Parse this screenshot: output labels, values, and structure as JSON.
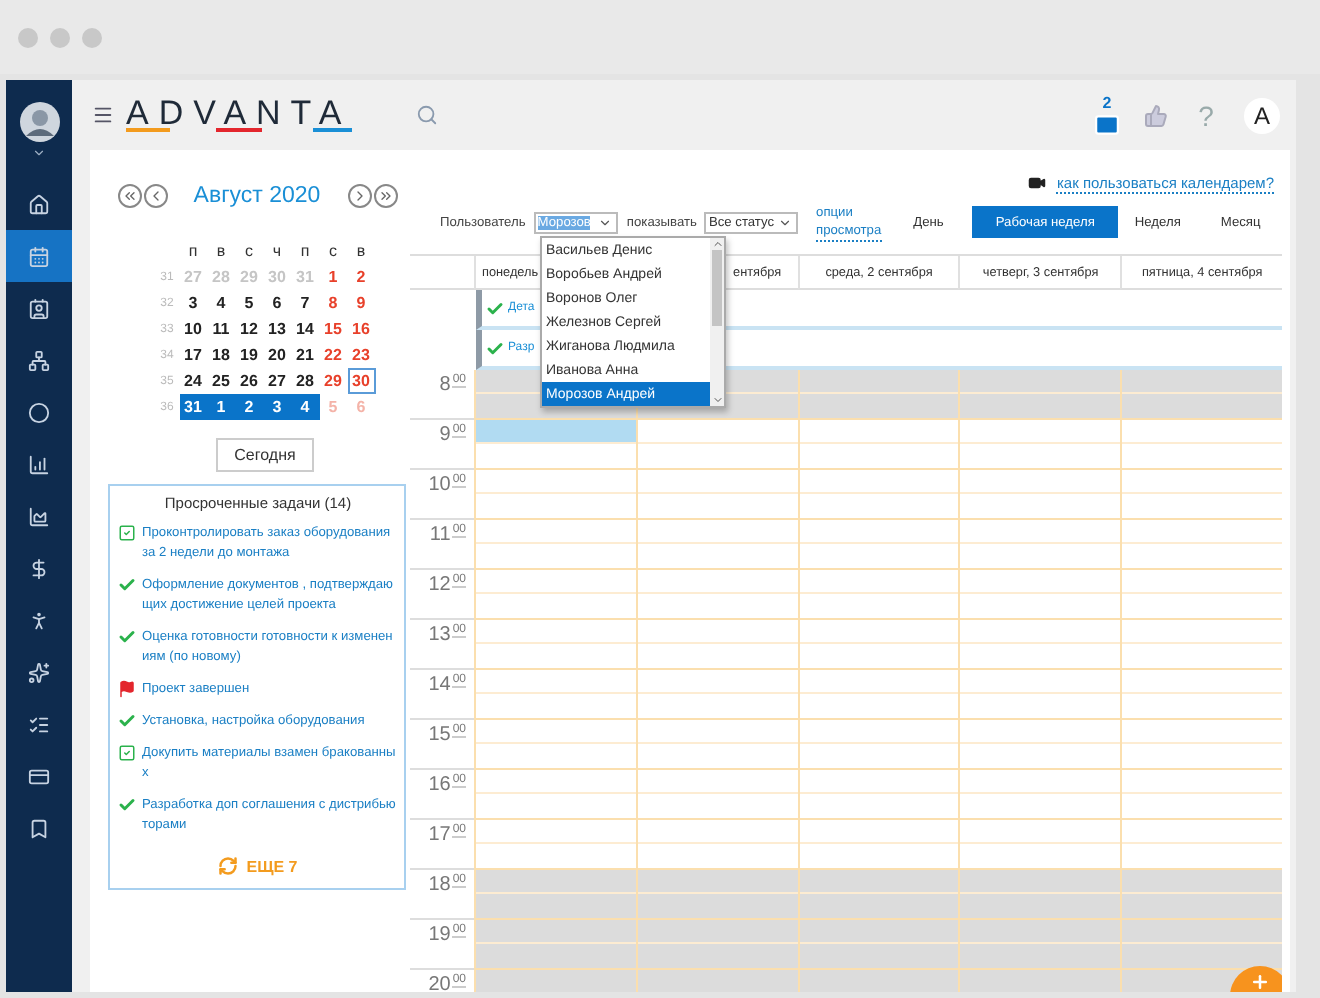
{
  "header": {
    "logo": "ADVANTA",
    "mail_count": "2",
    "help": "?",
    "profile_initial": "A"
  },
  "sidebar": {
    "items": [
      {
        "selected": false
      },
      {
        "selected": true
      },
      {
        "selected": false
      },
      {
        "selected": false
      },
      {
        "selected": false
      },
      {
        "selected": false
      },
      {
        "selected": false
      },
      {
        "selected": false
      },
      {
        "selected": false
      },
      {
        "selected": false
      },
      {
        "selected": false
      },
      {
        "selected": false
      },
      {
        "selected": false
      }
    ]
  },
  "mini_calendar": {
    "title": "Август 2020",
    "weekdays": [
      "п",
      "в",
      "с",
      "ч",
      "п",
      "с",
      "в"
    ],
    "weeks": [
      {
        "number": "31",
        "selected": false,
        "days": [
          {
            "day": "27",
            "kind": "other",
            "today": false
          },
          {
            "day": "28",
            "kind": "other",
            "today": false
          },
          {
            "day": "29",
            "kind": "other",
            "today": false
          },
          {
            "day": "30",
            "kind": "other",
            "today": false
          },
          {
            "day": "31",
            "kind": "other",
            "today": false
          },
          {
            "day": "1",
            "kind": "weekend",
            "today": false
          },
          {
            "day": "2",
            "kind": "weekend",
            "today": false
          }
        ]
      },
      {
        "number": "32",
        "selected": false,
        "days": [
          {
            "day": "3",
            "kind": "weekday",
            "today": false
          },
          {
            "day": "4",
            "kind": "weekday",
            "today": false
          },
          {
            "day": "5",
            "kind": "weekday",
            "today": false
          },
          {
            "day": "6",
            "kind": "weekday",
            "today": false
          },
          {
            "day": "7",
            "kind": "weekday",
            "today": false
          },
          {
            "day": "8",
            "kind": "weekend",
            "today": false
          },
          {
            "day": "9",
            "kind": "weekend",
            "today": false
          }
        ]
      },
      {
        "number": "33",
        "selected": false,
        "days": [
          {
            "day": "10",
            "kind": "weekday",
            "today": false
          },
          {
            "day": "11",
            "kind": "weekday",
            "today": false
          },
          {
            "day": "12",
            "kind": "weekday",
            "today": false
          },
          {
            "day": "13",
            "kind": "weekday",
            "today": false
          },
          {
            "day": "14",
            "kind": "weekday",
            "today": false
          },
          {
            "day": "15",
            "kind": "weekend",
            "today": false
          },
          {
            "day": "16",
            "kind": "weekend",
            "today": false
          }
        ]
      },
      {
        "number": "34",
        "selected": false,
        "days": [
          {
            "day": "17",
            "kind": "weekday",
            "today": false
          },
          {
            "day": "18",
            "kind": "weekday",
            "today": false
          },
          {
            "day": "19",
            "kind": "weekday",
            "today": false
          },
          {
            "day": "20",
            "kind": "weekday",
            "today": false
          },
          {
            "day": "21",
            "kind": "weekday",
            "today": false
          },
          {
            "day": "22",
            "kind": "weekend",
            "today": false
          },
          {
            "day": "23",
            "kind": "weekend",
            "today": false
          }
        ]
      },
      {
        "number": "35",
        "selected": false,
        "days": [
          {
            "day": "24",
            "kind": "weekday",
            "today": false
          },
          {
            "day": "25",
            "kind": "weekday",
            "today": false
          },
          {
            "day": "26",
            "kind": "weekday",
            "today": false
          },
          {
            "day": "27",
            "kind": "weekday",
            "today": false
          },
          {
            "day": "28",
            "kind": "weekday",
            "today": false
          },
          {
            "day": "29",
            "kind": "weekend",
            "today": false
          },
          {
            "day": "30",
            "kind": "weekend",
            "today": true
          }
        ]
      },
      {
        "number": "36",
        "selected": true,
        "days": [
          {
            "day": "31",
            "kind": "weekday",
            "today": false
          },
          {
            "day": "1",
            "kind": "weekday",
            "today": false
          },
          {
            "day": "2",
            "kind": "weekday",
            "today": false
          },
          {
            "day": "3",
            "kind": "weekday",
            "today": false
          },
          {
            "day": "4",
            "kind": "weekday",
            "today": false
          },
          {
            "day": "5",
            "kind": "other-weekend",
            "today": false
          },
          {
            "day": "6",
            "kind": "other-weekend",
            "today": false
          }
        ]
      }
    ],
    "today_button": "Сегодня"
  },
  "tasks": {
    "title": "Просроченные задачи (14)",
    "items": [
      {
        "kind": "checked-box",
        "text": "Проконтролировать заказ оборудования за 2 недели до монтажа"
      },
      {
        "kind": "check",
        "text": "Оформление документов , подтверждающих достижение целей проекта"
      },
      {
        "kind": "check",
        "text": "Оценка готовности готовности к изменениям (по новому)"
      },
      {
        "kind": "flag",
        "text": "Проект завершен"
      },
      {
        "kind": "check",
        "text": "Установка, настройка оборудования"
      },
      {
        "kind": "checked-box",
        "text": "Докупить материалы взамен бракованных"
      },
      {
        "kind": "check",
        "text": "Разработка доп соглашения с дистрибьюторами"
      }
    ],
    "more": "ЕЩЕ 7"
  },
  "help_link": "как пользоваться календарем?",
  "toolbar": {
    "user_label": "Пользователь",
    "user_value": "Морозов",
    "show_label": "показывать",
    "status_value": "Все статус",
    "options_link": "опции просмотра",
    "views": [
      {
        "label": "День",
        "selected": false
      },
      {
        "label": "Рабочая неделя",
        "selected": true
      },
      {
        "label": "Неделя",
        "selected": false
      },
      {
        "label": "Месяц",
        "selected": false
      }
    ]
  },
  "user_dropdown": {
    "options": [
      {
        "label": "Васильев Денис",
        "selected": false
      },
      {
        "label": "Воробьев Андрей",
        "selected": false
      },
      {
        "label": "Воронов Олег",
        "selected": false
      },
      {
        "label": "Железнов Сергей",
        "selected": false
      },
      {
        "label": "Жиганова Людмила",
        "selected": false
      },
      {
        "label": "Иванова Анна",
        "selected": false
      },
      {
        "label": "Морозов Андрей",
        "selected": true
      }
    ]
  },
  "calendar": {
    "columns": [
      "понедель",
      "ентября",
      "среда, 2 сентября",
      "четверг, 3 сентября",
      "пятница, 4 сентября"
    ],
    "all_day_events": [
      {
        "text": "Дета",
        "done": true
      },
      {
        "text": "Разр",
        "done": true
      }
    ],
    "hours": [
      {
        "hour": "8",
        "minutes": "00",
        "off_hours": true,
        "selected": false
      },
      {
        "hour": "9",
        "minutes": "00",
        "off_hours": false,
        "selected": true
      },
      {
        "hour": "10",
        "minutes": "00",
        "off_hours": false,
        "selected": false
      },
      {
        "hour": "11",
        "minutes": "00",
        "off_hours": false,
        "selected": false
      },
      {
        "hour": "12",
        "minutes": "00",
        "off_hours": false,
        "selected": false
      },
      {
        "hour": "13",
        "minutes": "00",
        "off_hours": false,
        "selected": false
      },
      {
        "hour": "14",
        "minutes": "00",
        "off_hours": false,
        "selected": false
      },
      {
        "hour": "15",
        "minutes": "00",
        "off_hours": false,
        "selected": false
      },
      {
        "hour": "16",
        "minutes": "00",
        "off_hours": false,
        "selected": false
      },
      {
        "hour": "17",
        "minutes": "00",
        "off_hours": false,
        "selected": false
      },
      {
        "hour": "18",
        "minutes": "00",
        "off_hours": true,
        "selected": false
      },
      {
        "hour": "19",
        "minutes": "00",
        "off_hours": true,
        "selected": false
      },
      {
        "hour": "20",
        "minutes": "00",
        "off_hours": true,
        "selected": false
      }
    ]
  }
}
